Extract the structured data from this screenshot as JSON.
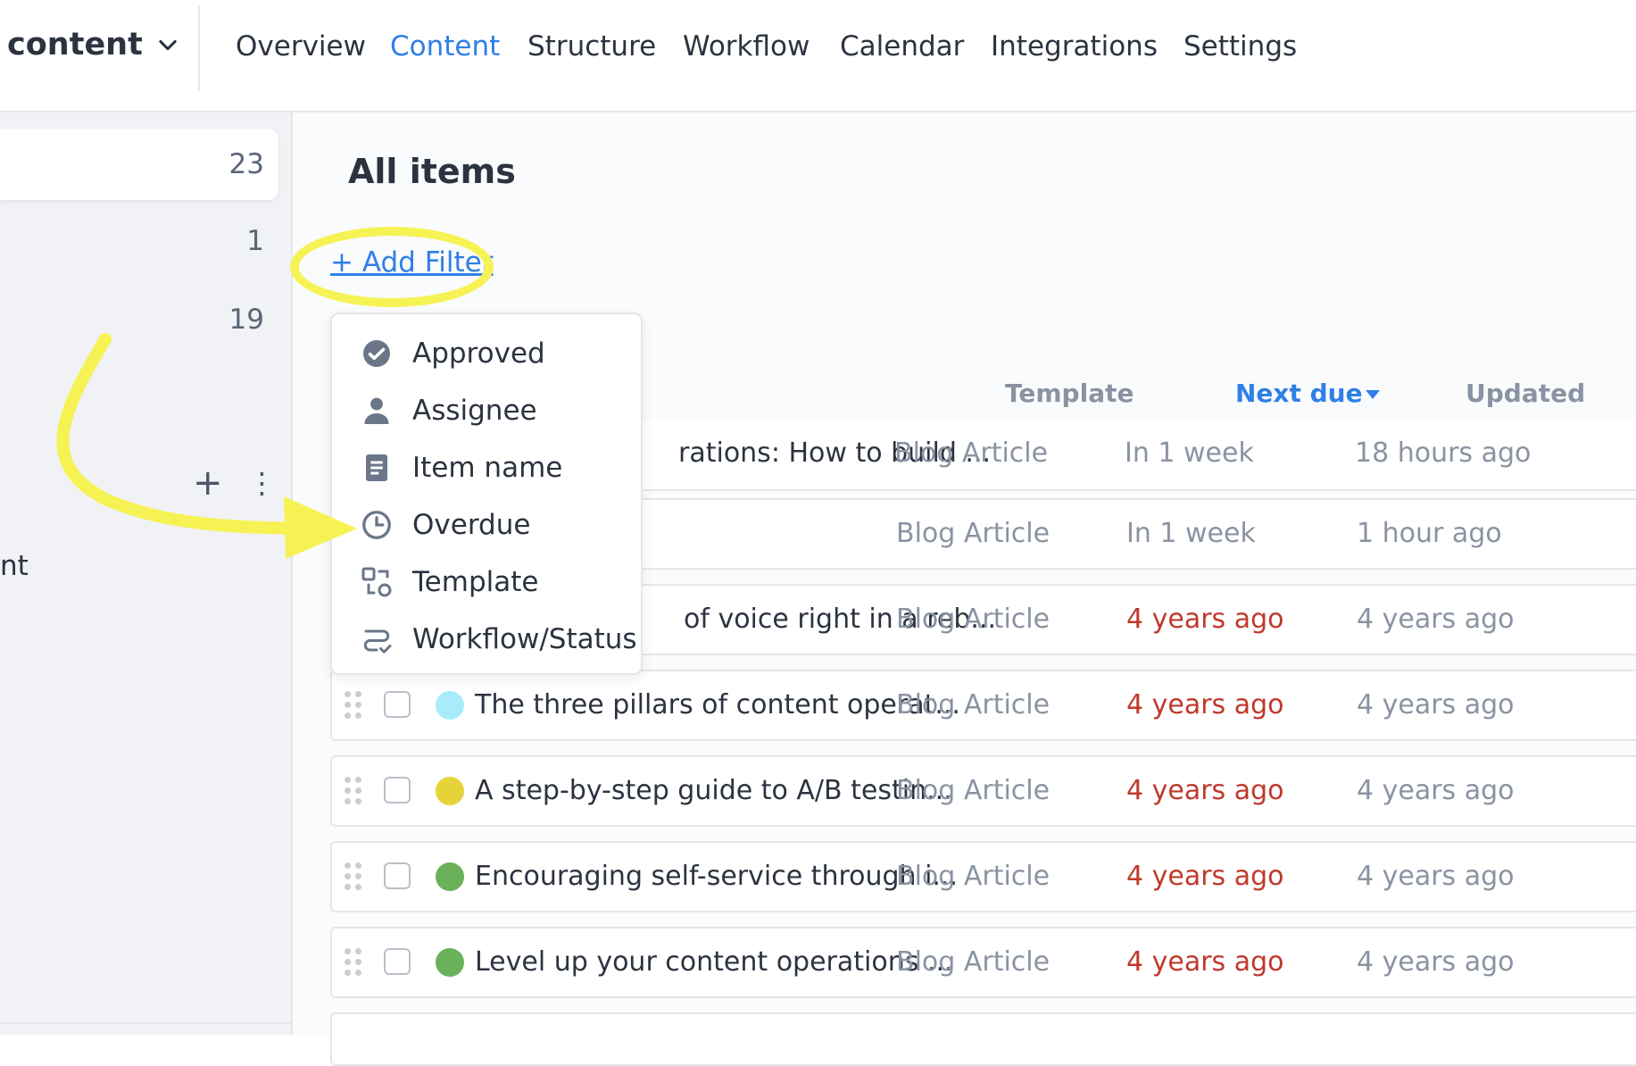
{
  "project": {
    "name": "content"
  },
  "nav": {
    "tabs": [
      {
        "label": "Overview"
      },
      {
        "label": "Content",
        "active": true
      },
      {
        "label": "Structure"
      },
      {
        "label": "Workflow"
      },
      {
        "label": "Calendar"
      },
      {
        "label": "Integrations"
      },
      {
        "label": "Settings"
      }
    ]
  },
  "sidebar": {
    "counts": [
      "23",
      "1",
      "19"
    ],
    "fragment": "nt"
  },
  "main": {
    "title": "All items",
    "add_filter": "+ Add Filter",
    "columns": {
      "template": "Template",
      "next_due": "Next due",
      "updated": "Updated"
    },
    "rows": [
      {
        "title": "rations: How to build ...",
        "template": "Blog Article",
        "next_due": "In 1 week",
        "updated": "18 hours ago",
        "overdue": false
      },
      {
        "title": "",
        "template": "Blog Article",
        "next_due": "In 1 week",
        "updated": "1 hour ago",
        "overdue": false
      },
      {
        "title": "of voice right in a reb...",
        "template": "Blog Article",
        "next_due": "4 years ago",
        "updated": "4 years ago",
        "overdue": true
      },
      {
        "title": "The three pillars of content operat...",
        "template": "Blog Article",
        "next_due": "4 years ago",
        "updated": "4 years ago",
        "overdue": true,
        "dot_color": "#a8ecfb"
      },
      {
        "title": "A step-by-step guide to A/B testin...",
        "template": "Blog Article",
        "next_due": "4 years ago",
        "updated": "4 years ago",
        "overdue": true,
        "dot_color": "#e6d33a"
      },
      {
        "title": "Encouraging self-service through i...",
        "template": "Blog Article",
        "next_due": "4 years ago",
        "updated": "4 years ago",
        "overdue": true,
        "dot_color": "#6ab159"
      },
      {
        "title": "Level up your content operations ...",
        "template": "Blog Article",
        "next_due": "4 years ago",
        "updated": "4 years ago",
        "overdue": true,
        "dot_color": "#6ab159"
      }
    ]
  },
  "filter_menu": {
    "items": [
      {
        "label": "Approved",
        "icon": "check-circle-icon"
      },
      {
        "label": "Assignee",
        "icon": "person-icon"
      },
      {
        "label": "Item name",
        "icon": "document-icon"
      },
      {
        "label": "Overdue",
        "icon": "clock-icon"
      },
      {
        "label": "Template",
        "icon": "template-icon"
      },
      {
        "label": "Workflow/Status",
        "icon": "workflow-icon"
      }
    ]
  },
  "colors": {
    "accent": "#2f7fe8",
    "overdue": "#c0392b",
    "highlight": "#f6f254"
  }
}
